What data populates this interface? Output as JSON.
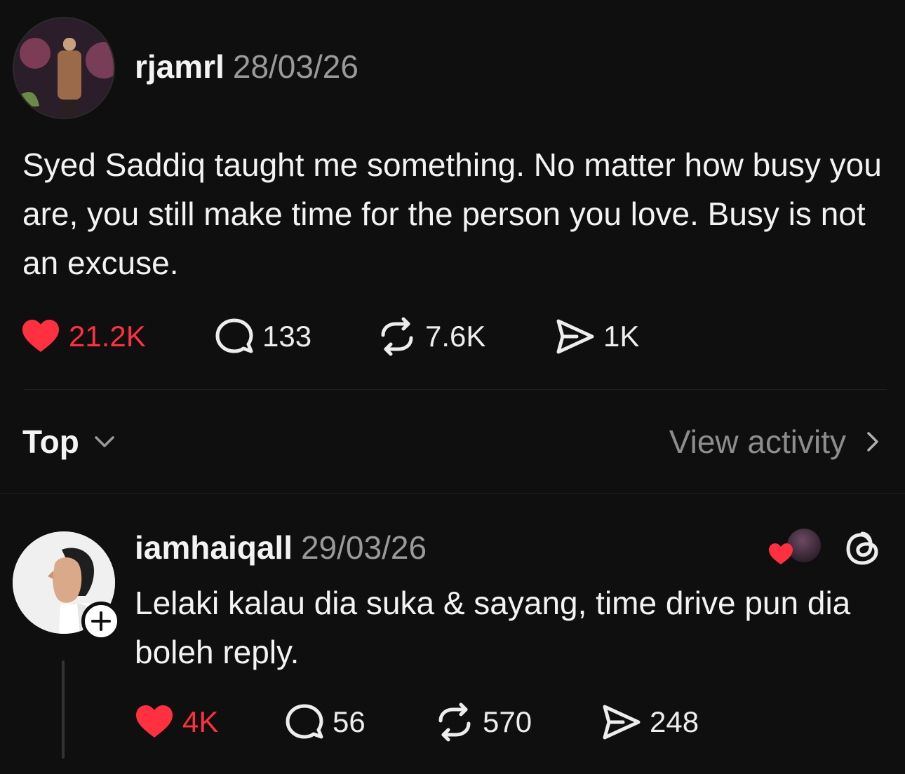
{
  "post": {
    "username": "rjamrl",
    "timestamp": "28/03/26",
    "text": "Syed Saddiq taught me something. No matter how busy you are, you still make time for the person you love. Busy is not an excuse.",
    "likes": "21.2K",
    "comments": "133",
    "reposts": "7.6K",
    "shares": "1K",
    "liked": true
  },
  "replies_toolbar": {
    "sort_label": "Top",
    "view_activity_label": "View activity"
  },
  "reply": {
    "username": "iamhaiqall",
    "timestamp": "29/03/26",
    "text": "Lelaki kalau dia suka & sayang, time drive pun dia boleh reply.",
    "likes": "4K",
    "comments": "56",
    "reposts": "570",
    "shares": "248",
    "liked": true
  },
  "icons": {
    "like": "heart-icon",
    "comment": "comment-bubble-icon",
    "repost": "repost-icon",
    "share": "send-icon",
    "app": "threads-icon",
    "follow": "plus-icon"
  },
  "colors": {
    "background": "#0f0f0f",
    "liked": "#ff3040",
    "muted_text": "#9a9a9a"
  }
}
